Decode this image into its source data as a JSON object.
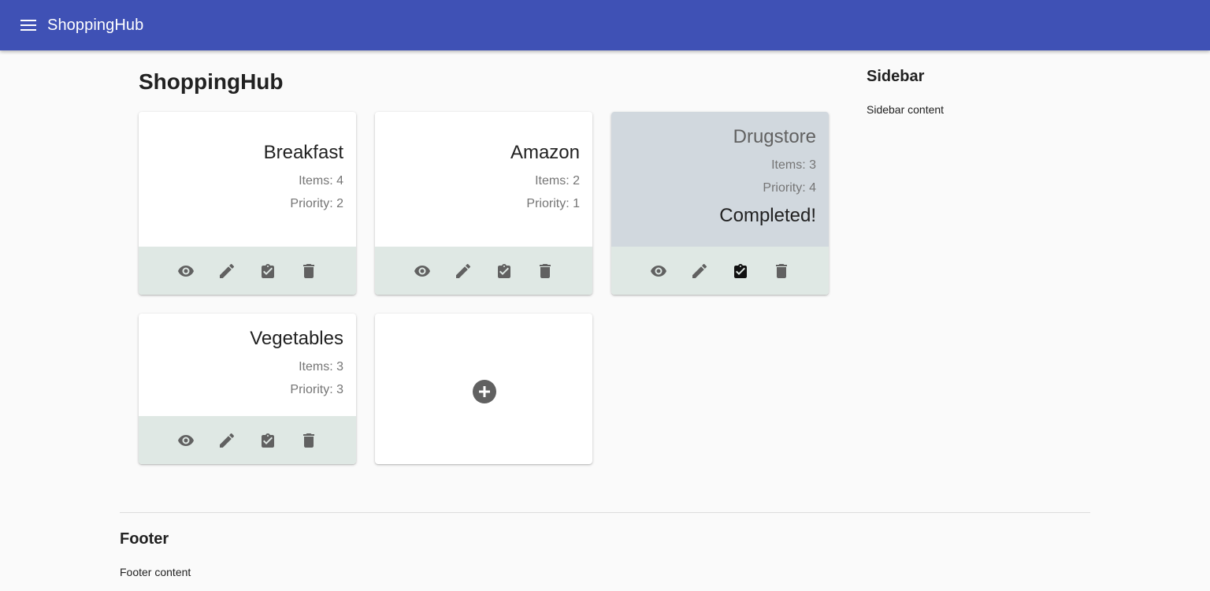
{
  "appbar": {
    "title": "ShoppingHub",
    "menu_icon": "menu-icon",
    "color": "#3f51b5"
  },
  "main": {
    "title": "ShoppingHub"
  },
  "cards": [
    {
      "name": "Breakfast",
      "items": "Items: 4",
      "priority": "Priority: 2"
    },
    {
      "name": "Amazon",
      "items": "Items: 2",
      "priority": "Priority: 1"
    },
    {
      "name": "Drugstore",
      "items": "Items: 3",
      "priority": "Priority: 4",
      "status": "Completed!"
    },
    {
      "name": "Vegetables",
      "items": "Items: 3",
      "priority": "Priority: 3"
    }
  ],
  "card_actions": [
    "view-icon",
    "edit-icon",
    "complete-icon",
    "delete-icon"
  ],
  "add_card": {
    "icon": "add-circle-icon"
  },
  "sidebar": {
    "title": "Sidebar",
    "content": "Sidebar content"
  },
  "footer": {
    "title": "Footer",
    "content": "Footer content"
  },
  "colors": {
    "completed_card": "#d1d8de",
    "actions_bar": "#dfe8e4",
    "icon": "#616161",
    "icon_active": "#212121"
  }
}
